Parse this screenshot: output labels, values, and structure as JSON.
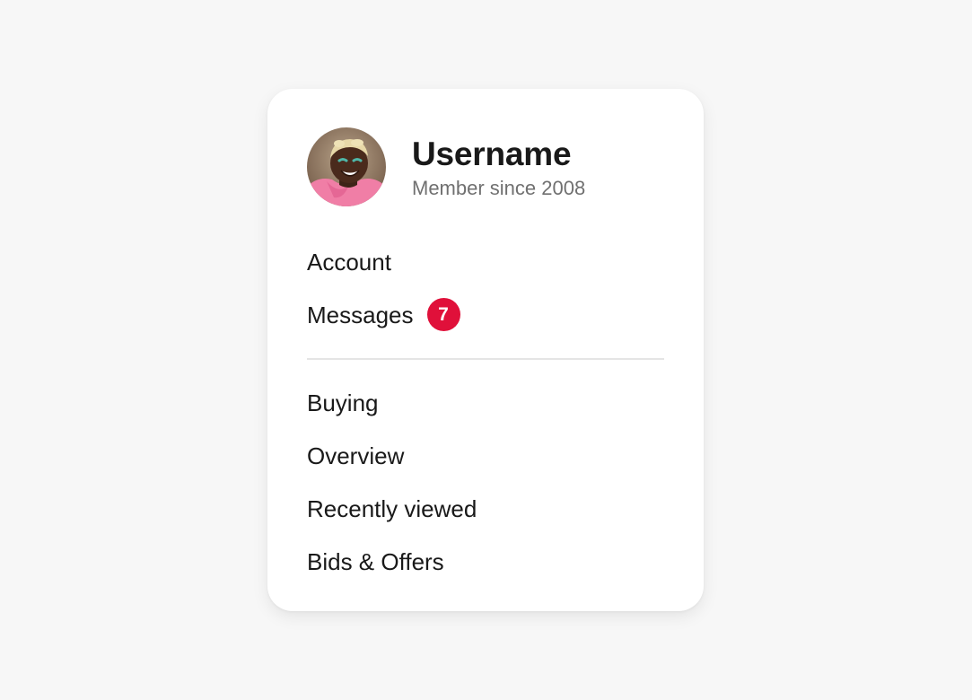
{
  "profile": {
    "username": "Username",
    "member_since": "Member since 2008"
  },
  "menu_primary": [
    {
      "label": "Account"
    },
    {
      "label": "Messages",
      "badge": "7"
    }
  ],
  "menu_secondary": [
    {
      "label": "Buying"
    },
    {
      "label": "Overview"
    },
    {
      "label": "Recently viewed"
    },
    {
      "label": "Bids & Offers"
    }
  ],
  "colors": {
    "badge": "#e0103a",
    "divider": "#e5e5e5",
    "background": "#f7f7f7"
  }
}
